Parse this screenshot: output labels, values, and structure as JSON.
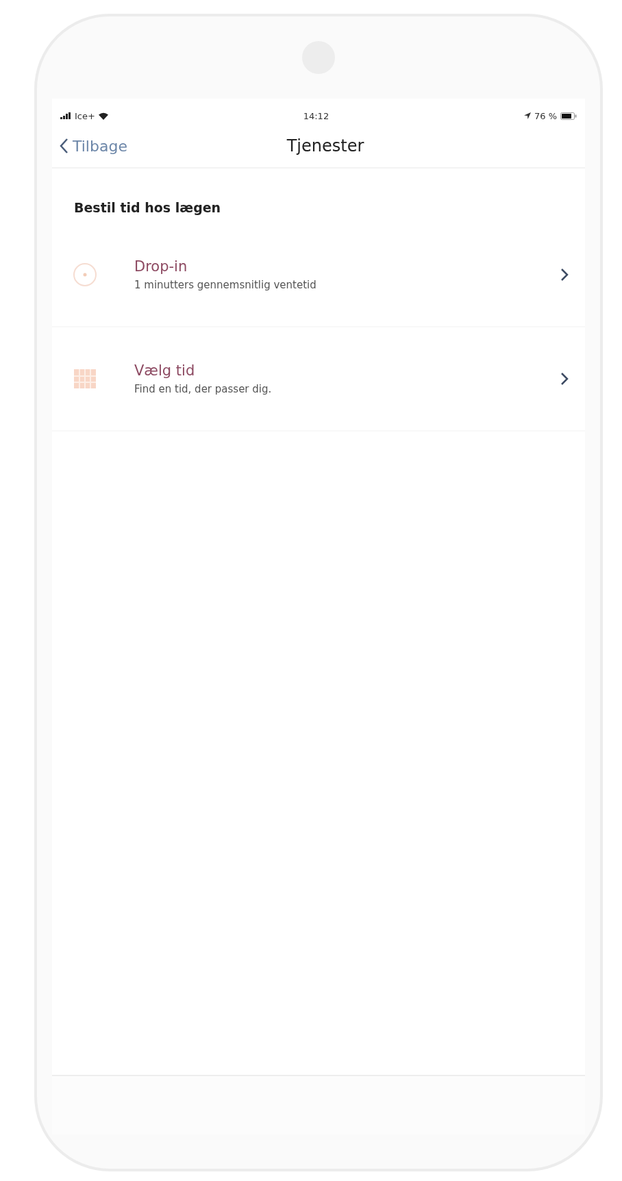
{
  "status_bar": {
    "carrier": "Ice+",
    "time": "14:12",
    "battery": "76 %"
  },
  "nav": {
    "back": "Tilbage",
    "title": "Tjenester"
  },
  "section": {
    "title": "Bestil tid hos lægen"
  },
  "items": [
    {
      "kind": "clock",
      "title": "Drop-in",
      "subtitle": "1 minutters gennemsnitlig ventetid"
    },
    {
      "kind": "calendar",
      "title": "Vælg tid",
      "subtitle": "Find en tid, der passer dig."
    }
  ]
}
